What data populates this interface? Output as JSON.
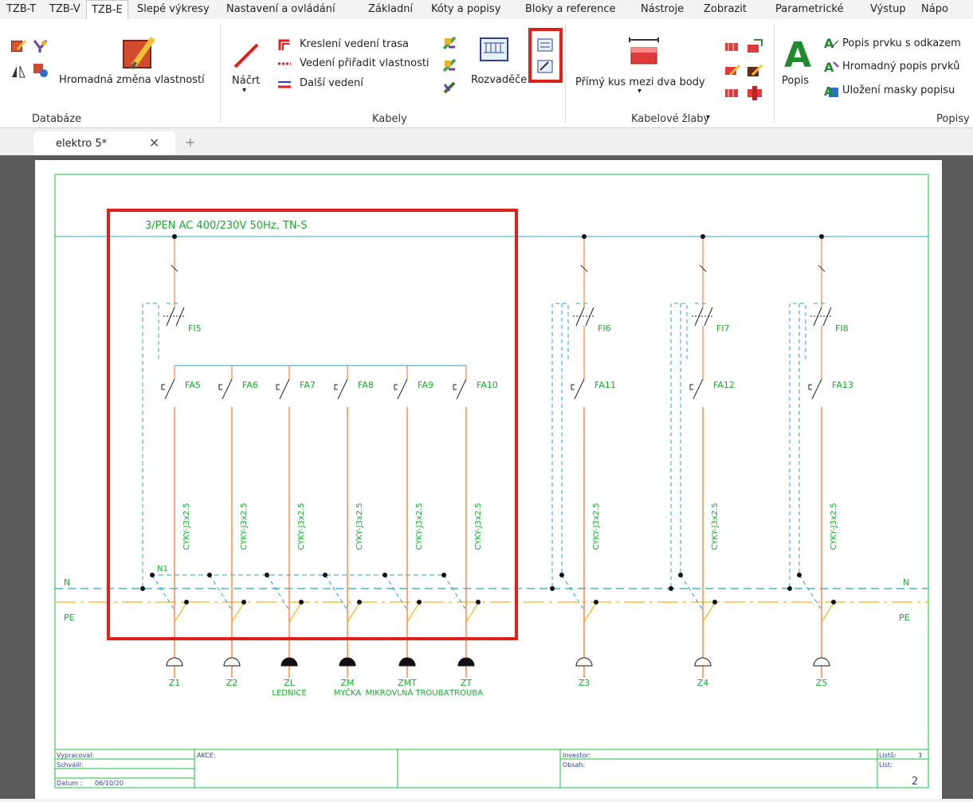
{
  "menu": {
    "tabs": [
      "TZB-T",
      "TZB-V",
      "TZB-E",
      "Slepé výkresy",
      "Nastavení a ovládání",
      "Základní",
      "Kóty a popisy",
      "Bloky a reference",
      "Nástroje",
      "Zobrazit",
      "Parametrické",
      "Výstup",
      "Nápo"
    ],
    "active": "TZB-E"
  },
  "ribbon": {
    "databaze": {
      "big_label": "Hromadná změna vlastností",
      "group": "Databáze"
    },
    "kabely": {
      "nacrt": "Náčrt",
      "kresleni": "Kreslení vedení trasa",
      "vedeni": "Vedení přiřadit vlastnosti",
      "dalsi": "Další vedení",
      "rozvadece": "Rozvaděče",
      "group": "Kabely"
    },
    "zlaby": {
      "primy": "Přímý kus mezi dva body",
      "group": "Kabelové žlaby"
    },
    "popisy": {
      "popis": "Popis",
      "popis_odkaz": "Popis prvku s odkazem",
      "hromadny": "Hromadný popis prvků",
      "ulozeni": "Uložení masky popisu",
      "group": "Popisy"
    }
  },
  "document_tab": {
    "title": "elektro 5*"
  },
  "drawing": {
    "supply": "3/PEN AC 400/230V 50Hz, TN-S",
    "rcds": [
      "FI5",
      "FI6",
      "FI7",
      "FI8"
    ],
    "breakers": [
      "FA5",
      "FA6",
      "FA7",
      "FA8",
      "FA9",
      "FA10",
      "FA11",
      "FA12",
      "FA13"
    ],
    "cable": "CYKY-J3x2.5",
    "n_label": "N",
    "pe_label": "PE",
    "n1_label": "N1",
    "loads": [
      {
        "id": "Z1",
        "name": ""
      },
      {
        "id": "Z2",
        "name": ""
      },
      {
        "id": "ZL",
        "name": "LEDNICE"
      },
      {
        "id": "ZM",
        "name": "MYČKA"
      },
      {
        "id": "ZMT",
        "name": "MIKROVLNÁ TROUBA"
      },
      {
        "id": "ZT",
        "name": "TROUBA"
      },
      {
        "id": "Z3",
        "name": ""
      },
      {
        "id": "Z4",
        "name": ""
      },
      {
        "id": "Z5",
        "name": ""
      }
    ],
    "title_block": {
      "vypracoval": "Vypracoval:",
      "schvalil": "Schválil:",
      "datum_label": "Datum  :",
      "datum": "06/10/20",
      "akce": "AKCE:",
      "investor": "Investor:",
      "obsah": "Obsah:",
      "listu_label": "Listů:",
      "listu": "3",
      "list_label": "List:",
      "list": "2"
    }
  },
  "colors": {
    "red_highlight": "#e0201b",
    "wire": "#ff6a1a",
    "cyan": "#2a9fc9",
    "green_text": "#1aa82e",
    "yellow_pe": "#f3b516",
    "frame": "#1bbf3c"
  }
}
